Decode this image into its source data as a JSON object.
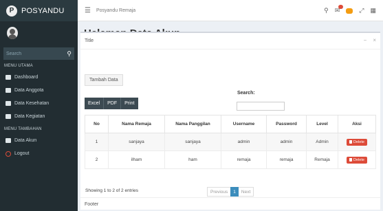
{
  "brand": {
    "logo_letter": "P",
    "name": "POSYANDU"
  },
  "sidebar": {
    "search_placeholder": "Search",
    "menu_header_1": "MENU UTAMA",
    "items_main": [
      {
        "label": "Dashboard",
        "icon": "dashboard-icon"
      },
      {
        "label": "Data Anggota",
        "icon": "table-icon"
      },
      {
        "label": "Data Kesehatan",
        "icon": "book-icon"
      },
      {
        "label": "Data Kegiatan",
        "icon": "plus-square-icon"
      }
    ],
    "menu_header_2": "MENU TAMBAHAN",
    "items_extra": [
      {
        "label": "Data Akun",
        "icon": "table-icon"
      },
      {
        "label": "Logout",
        "icon": "circle-icon"
      }
    ]
  },
  "topbar": {
    "breadcrumb": "Posyandu Remaja"
  },
  "page": {
    "title": "Halaman Data Akun"
  },
  "card": {
    "title": "Title",
    "add_button": "Tambah Data",
    "export_buttons": [
      "Excel",
      "PDF",
      "Print"
    ],
    "search_label": "Search:",
    "footer": "Footer"
  },
  "table": {
    "headers": [
      "No",
      "Nama Remaja",
      "Nama Panggilan",
      "Username",
      "Password",
      "Level",
      "Aksi"
    ],
    "rows": [
      [
        "1",
        "sanjaya",
        "sanjaya",
        "admin",
        "admin",
        "Admin"
      ],
      [
        "2",
        "ilham",
        "ham",
        "remaja",
        "remaja",
        "Remaja"
      ]
    ],
    "delete_label": "Delete"
  },
  "datatable": {
    "info": "Showing 1 to 2 of 2 entries",
    "previous": "Previous",
    "current_page": "1",
    "next": "Next"
  },
  "colors": {
    "sidebar_bg": "#222d32",
    "delete": "#dd4b39",
    "pager_active": "#3c8dbc"
  }
}
